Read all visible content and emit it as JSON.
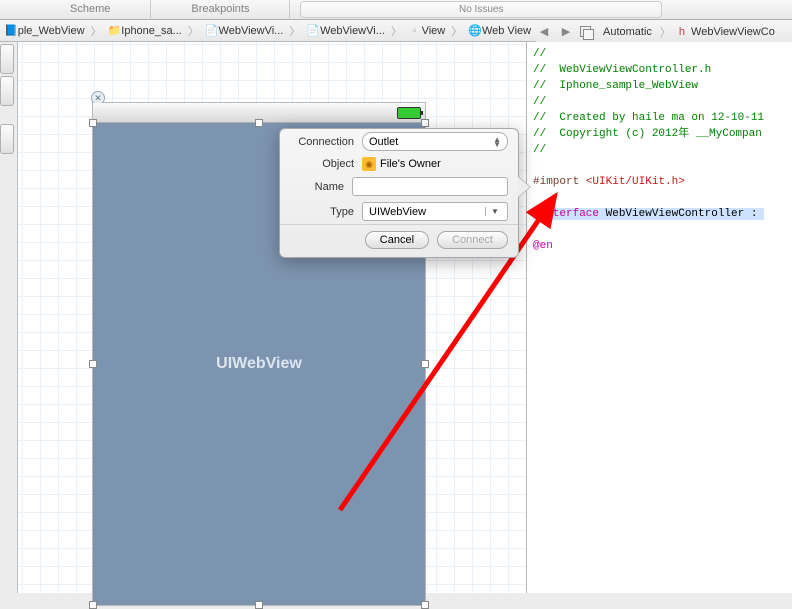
{
  "topTabs": {
    "scheme": "Scheme",
    "breakpoints": "Breakpoints",
    "issues": "No Issues"
  },
  "pathBar": {
    "items": [
      {
        "label": "ple_WebView"
      },
      {
        "label": "Iphone_sa..."
      },
      {
        "label": "WebViewVi..."
      },
      {
        "label": "WebViewVi..."
      },
      {
        "label": "View"
      },
      {
        "label": "Web View"
      }
    ]
  },
  "rightBar": {
    "auto": "Automatic",
    "file": "WebViewViewCo"
  },
  "canvas": {
    "webview_label": "UIWebView"
  },
  "popover": {
    "labels": {
      "connection": "Connection",
      "object": "Object",
      "name": "Name",
      "type": "Type"
    },
    "values": {
      "connection": "Outlet",
      "object": "File's Owner",
      "name": "",
      "type": "UIWebView"
    },
    "buttons": {
      "cancel": "Cancel",
      "connect": "Connect"
    }
  },
  "code": {
    "l1": "//",
    "l2": "//  WebViewViewController.h",
    "l3": "//  Iphone_sample_WebView",
    "l4": "//",
    "l5": "//  Created by haile ma on 12-10-11",
    "l6": "//  Copyright (c) 2012年 __MyCompan",
    "l7": "//",
    "import_dir": "#import ",
    "import_hdr": "<UIKit/UIKit.h>",
    "iface_kw": "@interface",
    "iface_name": " WebViewViewController : ",
    "end_partial": "@en"
  }
}
